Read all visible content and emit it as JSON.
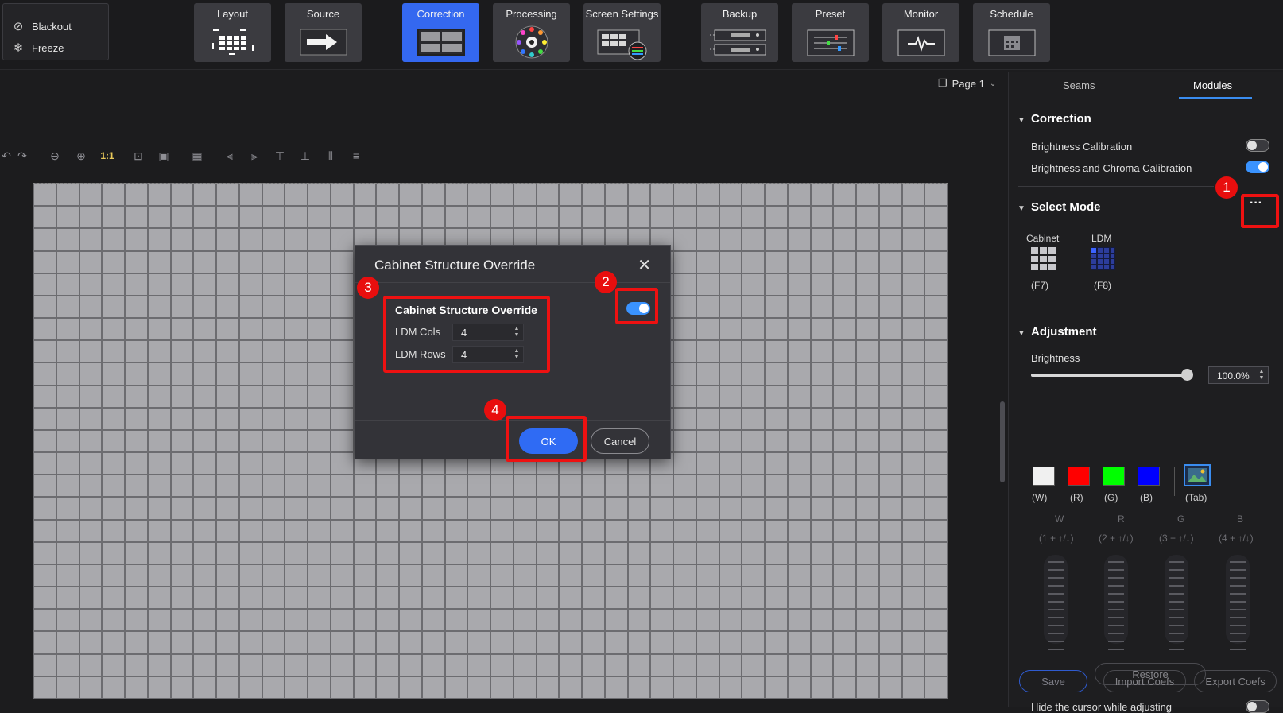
{
  "quick": {
    "blackout_label": "Blackout",
    "freeze_label": "Freeze"
  },
  "toolbar": {
    "items": [
      {
        "label": "Layout",
        "icon": "layout-grid-icon"
      },
      {
        "label": "Source",
        "icon": "source-arrow-icon"
      },
      {
        "label": "Correction",
        "icon": "correction-icon",
        "active": true
      },
      {
        "label": "Processing",
        "icon": "processing-color-wheel-icon"
      },
      {
        "label": "Screen Settings",
        "icon": "screen-settings-icon"
      },
      {
        "label": "Backup",
        "icon": "backup-icon"
      },
      {
        "label": "Preset",
        "icon": "preset-sliders-icon"
      },
      {
        "label": "Monitor",
        "icon": "monitor-pulse-icon"
      },
      {
        "label": "Schedule",
        "icon": "schedule-calendar-icon"
      }
    ],
    "active_color": "#3468f0"
  },
  "editor": {
    "zoom_label": "1:1",
    "page_label": "Page 1"
  },
  "panel": {
    "tabs": [
      "Seams",
      "Modules"
    ],
    "active_tab": "Modules",
    "correction": {
      "title": "Correction",
      "brightness_calibration": {
        "label": "Brightness Calibration",
        "on": false
      },
      "chroma_calibration": {
        "label": "Brightness and Chroma Calibration",
        "on": true
      }
    },
    "select_mode": {
      "title": "Select Mode",
      "more_icon": "ellipsis-icon",
      "modes": [
        {
          "label": "Cabinet",
          "key": "(F7)"
        },
        {
          "label": "LDM",
          "key": "(F8)"
        }
      ]
    },
    "adjustment": {
      "title": "Adjustment",
      "brightness_label": "Brightness",
      "brightness_value": "100.0%",
      "brightness_fraction": 1.0,
      "swatches": [
        {
          "key": "(W)",
          "color": "#f0f0f0"
        },
        {
          "key": "(R)",
          "color": "#ff0000"
        },
        {
          "key": "(G)",
          "color": "#00ff00"
        },
        {
          "key": "(B)",
          "color": "#0000ff"
        }
      ],
      "tab_key": "(Tab)",
      "channels": [
        {
          "name": "W",
          "hint": "(1 + ↑/↓)"
        },
        {
          "name": "R",
          "hint": "(2 + ↑/↓)"
        },
        {
          "name": "G",
          "hint": "(3 + ↑/↓)"
        },
        {
          "name": "B",
          "hint": "(4 + ↑/↓)"
        }
      ],
      "restore_label": "Restore",
      "hide_cursor_label": "Hide the cursor while adjusting",
      "hide_cursor_on": false
    },
    "footer": {
      "save_label": "Save",
      "import_label": "Import Coefs",
      "export_label": "Export Coefs"
    }
  },
  "dialog": {
    "title": "Cabinet Structure Override",
    "toggle_on": true,
    "section_title": "Cabinet Structure Override",
    "cols_label": "LDM Cols",
    "cols_value": "4",
    "rows_label": "LDM Rows",
    "rows_value": "4",
    "ok_label": "OK",
    "cancel_label": "Cancel"
  },
  "annotations": {
    "markers": [
      "1",
      "2",
      "3",
      "4"
    ],
    "color": "#ee1111"
  }
}
